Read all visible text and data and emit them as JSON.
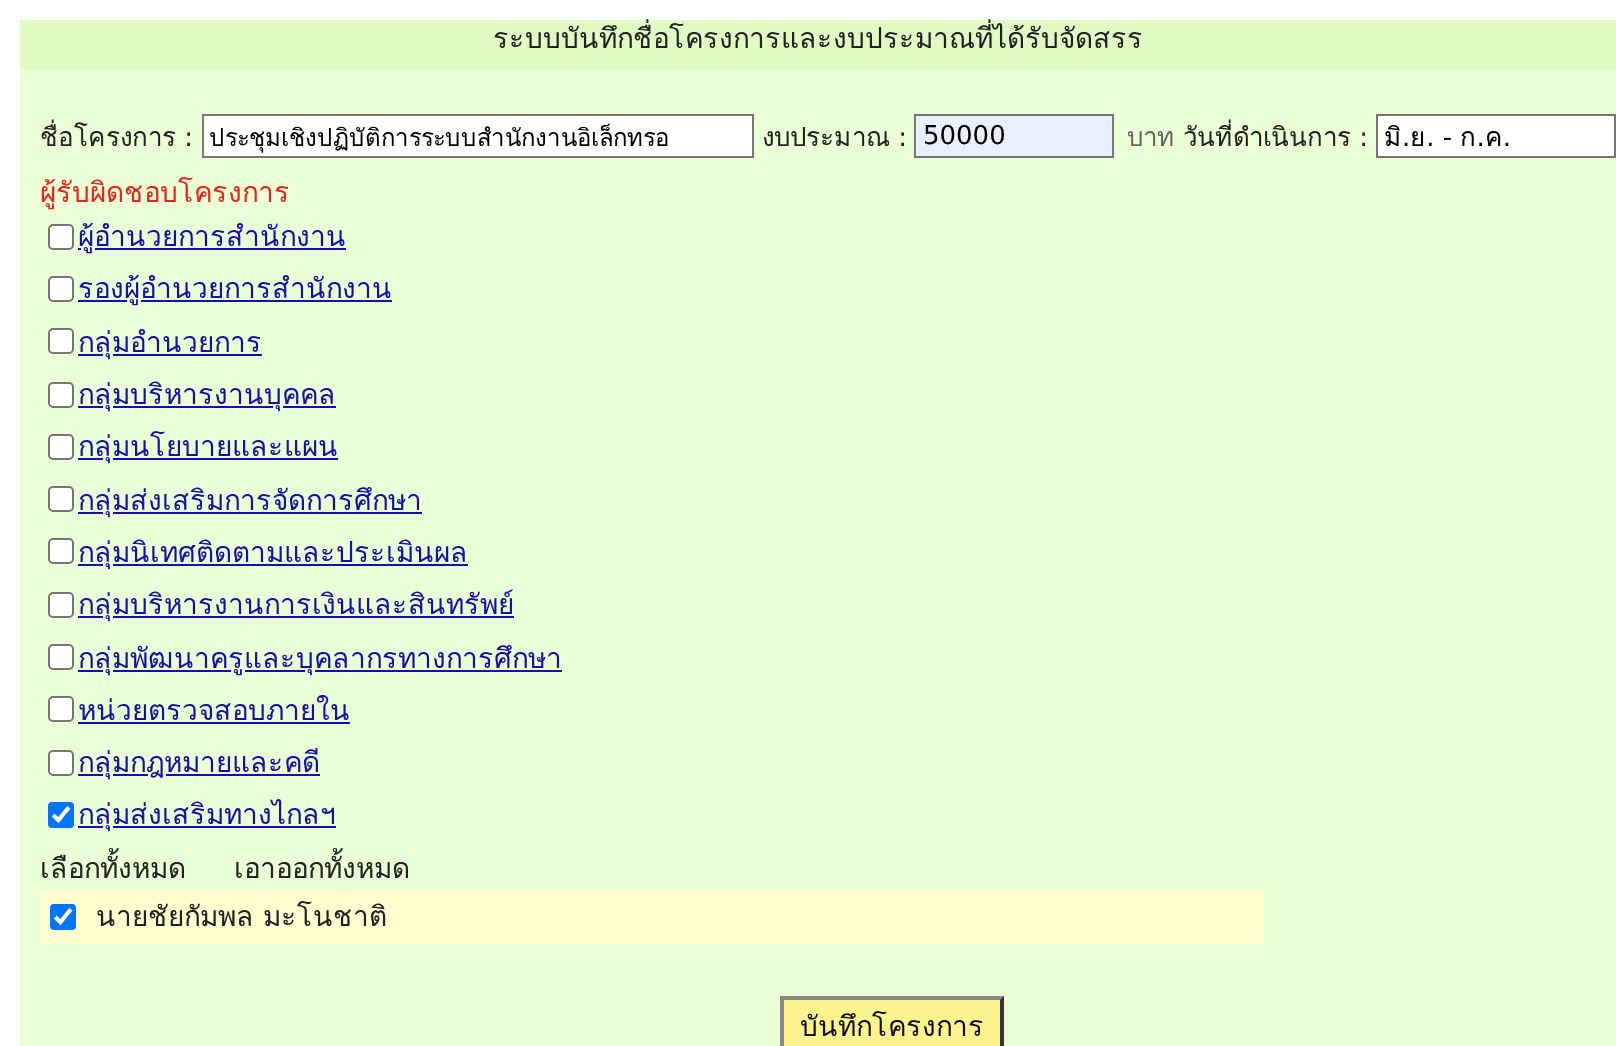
{
  "title": "ระบบบันทึกชื่อโครงการและงบประมาณที่ได้รับจัดสรร",
  "form": {
    "project_label": "ชื่อโครงการ :",
    "project_value": "ประชุมเชิงปฏิบัติการระบบสำนักงานอิเล็กทรอ",
    "budget_label": "งบประมาณ :",
    "budget_value": "50000",
    "currency": "บาท",
    "date_label": "วันที่ดำเนินการ :",
    "date_value": "มิ.ย. - ก.ค."
  },
  "responsible_heading": "ผู้รับผิดชอบโครงการ",
  "groups": [
    {
      "label": "ผู้อำนวยการสำนักงาน",
      "checked": false
    },
    {
      "label": "รองผู้อำนวยการสำนักงาน",
      "checked": false
    },
    {
      "label": "กลุ่มอำนวยการ",
      "checked": false
    },
    {
      "label": "กลุ่มบริหารงานบุคคล",
      "checked": false
    },
    {
      "label": "กลุ่มนโยบายและแผน",
      "checked": false
    },
    {
      "label": "กลุ่มส่งเสริมการจัดการศึกษา",
      "checked": false
    },
    {
      "label": "กลุ่มนิเทศติดตามและประเมินผล",
      "checked": false
    },
    {
      "label": "กลุ่มบริหารงานการเงินและสินทรัพย์",
      "checked": false
    },
    {
      "label": "กลุ่มพัฒนาครูและบุคลากรทางการศึกษา",
      "checked": false
    },
    {
      "label": "หน่วยตรวจสอบภายใน",
      "checked": false
    },
    {
      "label": "กลุ่มกฎหมายและคดี",
      "checked": false
    },
    {
      "label": "กลุ่มส่งเสริมทางไกลฯ",
      "checked": true
    }
  ],
  "select_all": "เลือกทั้งหมด",
  "deselect_all": "เอาออกทั้งหมด",
  "people": [
    {
      "name": "นายชัยกัมพล มะโนชาติ",
      "checked": true
    }
  ],
  "save_button": "บันทึกโครงการ"
}
